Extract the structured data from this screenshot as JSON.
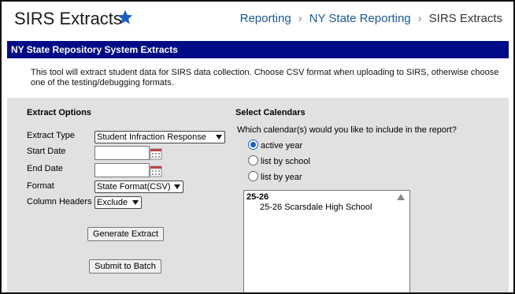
{
  "header": {
    "title": "SIRS Extracts",
    "breadcrumbs": [
      "Reporting",
      "NY State Reporting",
      "SIRS Extracts"
    ]
  },
  "section_bar": {
    "title": "NY State Repository System Extracts"
  },
  "description": "This tool will extract student data for SIRS data collection. Choose CSV format when uploading to SIRS, otherwise choose one of the testing/debugging formats.",
  "extract_options": {
    "heading": "Extract Options",
    "extract_type_label": "Extract Type",
    "extract_type_value": "Student Infraction Response",
    "start_date_label": "Start Date",
    "start_date_value": "",
    "end_date_label": "End Date",
    "end_date_value": "",
    "format_label": "Format",
    "format_value": "State Format(CSV)",
    "column_headers_label": "Column Headers",
    "column_headers_value": "Exclude",
    "generate_button": "Generate Extract",
    "batch_button": "Submit to Batch"
  },
  "calendars": {
    "heading": "Select Calendars",
    "question": "Which calendar(s) would you like to include in the report?",
    "options": [
      "active year",
      "list by school",
      "list by year"
    ],
    "selected_option": "active year",
    "list_group": "25-26",
    "list_item": "25-26 Scarsdale High School"
  },
  "colors": {
    "bar": "#000c85",
    "link": "#1b5a91",
    "star": "#1a5fc2",
    "panel": "#e1e1e1"
  }
}
